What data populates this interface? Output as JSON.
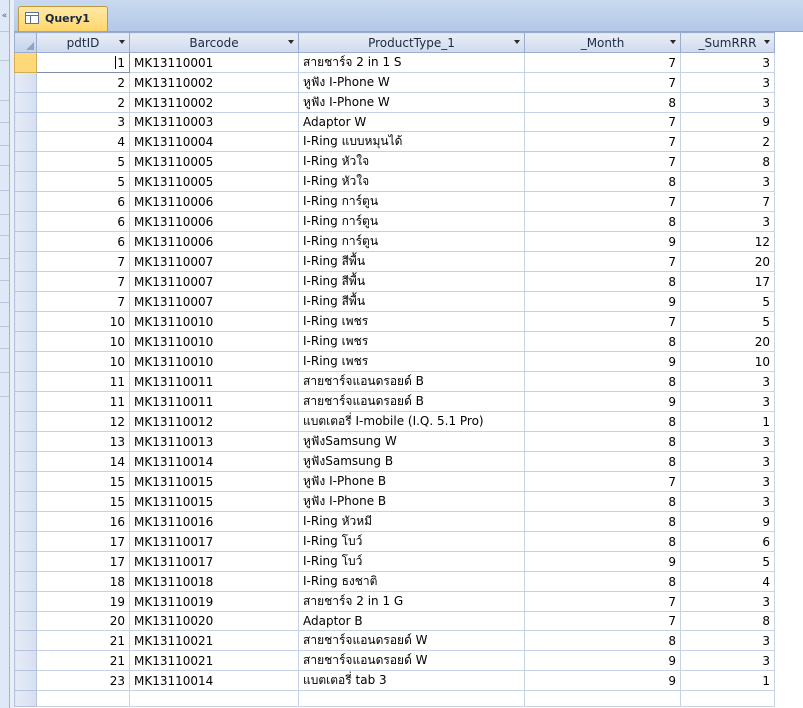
{
  "tab": {
    "label": "Query1"
  },
  "columns": [
    "pdtID",
    "Barcode",
    "ProductType_1",
    "_Month",
    "_SumRRR"
  ],
  "rows": [
    [
      "1",
      "MK13110001",
      "สายชาร์จ   2  in 1 S",
      "7",
      "3"
    ],
    [
      "2",
      "MK13110002",
      "หูฟัง    I-Phone W",
      "7",
      "3"
    ],
    [
      "2",
      "MK13110002",
      "หูฟัง    I-Phone W",
      "8",
      "3"
    ],
    [
      "3",
      "MK13110003",
      "Adaptor W",
      "7",
      "9"
    ],
    [
      "4",
      "MK13110004",
      "I-Ring แบบหมุนได้",
      "7",
      "2"
    ],
    [
      "5",
      "MK13110005",
      "I-Ring หัวใจ",
      "7",
      "8"
    ],
    [
      "5",
      "MK13110005",
      "I-Ring หัวใจ",
      "8",
      "3"
    ],
    [
      "6",
      "MK13110006",
      "I-Ring การ์ตูน",
      "7",
      "7"
    ],
    [
      "6",
      "MK13110006",
      "I-Ring การ์ตูน",
      "8",
      "3"
    ],
    [
      "6",
      "MK13110006",
      "I-Ring การ์ตูน",
      "9",
      "12"
    ],
    [
      "7",
      "MK13110007",
      "I-Ring สีพื้น",
      "7",
      "20"
    ],
    [
      "7",
      "MK13110007",
      "I-Ring สีพื้น",
      "8",
      "17"
    ],
    [
      "7",
      "MK13110007",
      "I-Ring สีพื้น",
      "9",
      "5"
    ],
    [
      "10",
      "MK13110010",
      "I-Ring เพชร",
      "7",
      "5"
    ],
    [
      "10",
      "MK13110010",
      "I-Ring เพชร",
      "8",
      "20"
    ],
    [
      "10",
      "MK13110010",
      "I-Ring เพชร",
      "9",
      "10"
    ],
    [
      "11",
      "MK13110011",
      "สายชาร์จแอนดรอยด์   B",
      "8",
      "3"
    ],
    [
      "11",
      "MK13110011",
      "สายชาร์จแอนดรอยด์   B",
      "9",
      "3"
    ],
    [
      "12",
      "MK13110012",
      "แบตเตอรี่   I-mobile (I.Q. 5.1 Pro)",
      "8",
      "1"
    ],
    [
      "13",
      "MK13110013",
      "หูฟังSamsung W",
      "8",
      "3"
    ],
    [
      "14",
      "MK13110014",
      "หูฟังSamsung B",
      "8",
      "3"
    ],
    [
      "15",
      "MK13110015",
      "หูฟัง    I-Phone B",
      "7",
      "3"
    ],
    [
      "15",
      "MK13110015",
      "หูฟัง    I-Phone B",
      "8",
      "3"
    ],
    [
      "16",
      "MK13110016",
      "I-Ring หัวหมี",
      "8",
      "9"
    ],
    [
      "17",
      "MK13110017",
      "I-Ring โบว์",
      "8",
      "6"
    ],
    [
      "17",
      "MK13110017",
      "I-Ring โบว์",
      "9",
      "5"
    ],
    [
      "18",
      "MK13110018",
      "I-Ring ธงชาติ",
      "8",
      "4"
    ],
    [
      "19",
      "MK13110019",
      "สายชาร์จ   2 in 1 G",
      "7",
      "3"
    ],
    [
      "20",
      "MK13110020",
      "Adaptor B",
      "7",
      "8"
    ],
    [
      "21",
      "MK13110021",
      "สายชาร์จแอนดรอยด์   W",
      "8",
      "3"
    ],
    [
      "21",
      "MK13110021",
      "สายชาร์จแอนดรอยด์   W",
      "9",
      "3"
    ],
    [
      "23",
      "MK13110014",
      "แบตเตอรี่   tab 3",
      "9",
      "1"
    ]
  ]
}
